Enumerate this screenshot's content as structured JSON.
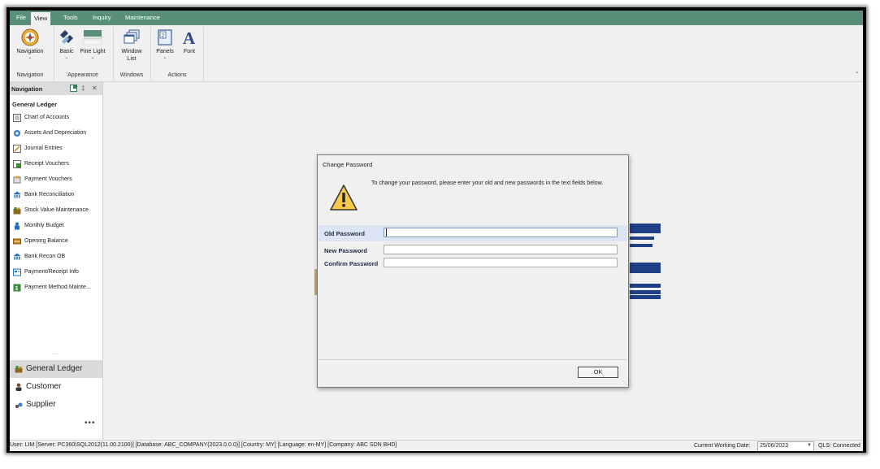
{
  "menubar": {
    "items": [
      "File",
      "View",
      "Tools",
      "Inquiry",
      "Maintenance"
    ],
    "active": "View"
  },
  "ribbon": {
    "buttons": {
      "navigation": "Navigation",
      "basic": "Basic",
      "pine_light": "Pine Light",
      "window_list_1": "Window",
      "window_list_2": "List",
      "panels": "Panels",
      "font": "Font"
    },
    "groups": {
      "navigation": "Navigation",
      "appearance": "Appearance",
      "windows": "Windows",
      "actions": "Actions"
    }
  },
  "nav": {
    "title": "Navigation",
    "section": "General Ledger",
    "items": [
      {
        "label": "Chart of Accounts",
        "icon": "chart-of-accounts-icon"
      },
      {
        "label": "Assets And Depreciation",
        "icon": "gear-icon"
      },
      {
        "label": "Journal Entries",
        "icon": "journal-icon"
      },
      {
        "label": "Receipt Vouchers",
        "icon": "receipt-icon"
      },
      {
        "label": "Payment Vouchers",
        "icon": "payment-icon"
      },
      {
        "label": "Bank Reconciliation",
        "icon": "bank-icon"
      },
      {
        "label": "Stock Value Maintenance",
        "icon": "stock-icon"
      },
      {
        "label": "Monthly Budget",
        "icon": "budget-icon"
      },
      {
        "label": "Opening Balance",
        "icon": "opening-balance-icon"
      },
      {
        "label": "Bank Recon OB",
        "icon": "bank-icon"
      },
      {
        "label": "Payment/Receipt Info",
        "icon": "info-icon"
      },
      {
        "label": "Payment Method Mainte...",
        "icon": "money-icon"
      }
    ],
    "modules": [
      {
        "label": "General Ledger",
        "icon": "ledger-icon",
        "active": true
      },
      {
        "label": "Customer",
        "icon": "customer-icon",
        "active": false
      },
      {
        "label": "Supplier",
        "icon": "supplier-icon",
        "active": false
      }
    ],
    "dots": "....",
    "more": "•••"
  },
  "dialog": {
    "title": "Change Password",
    "message": "To change your password, please enter your old and new passwords in the text fields below.",
    "old_password_label": "Old Password",
    "new_password_label": "New Password",
    "confirm_password_label": "Confirm Password",
    "old_password_value": "",
    "new_password_value": "",
    "confirm_password_value": "",
    "ok_label": "OK"
  },
  "statusbar": {
    "text": "User: LIM  [Server: PC360\\SQL2012(11.00.2100)]  [Database: ABC_COMPANY(2023.0.0.0)]  [Country: MY]  [Language: en-MY]  [Company: ABC SDN BHD]",
    "working_date_label": "Current Working Date:",
    "working_date": "25/06/2023",
    "qls": "QLS: Connected"
  },
  "colors": {
    "menubar": "#5a8f77",
    "logo_bars": "#1f3f86",
    "dialog_highlight": "#dbe5f3"
  }
}
